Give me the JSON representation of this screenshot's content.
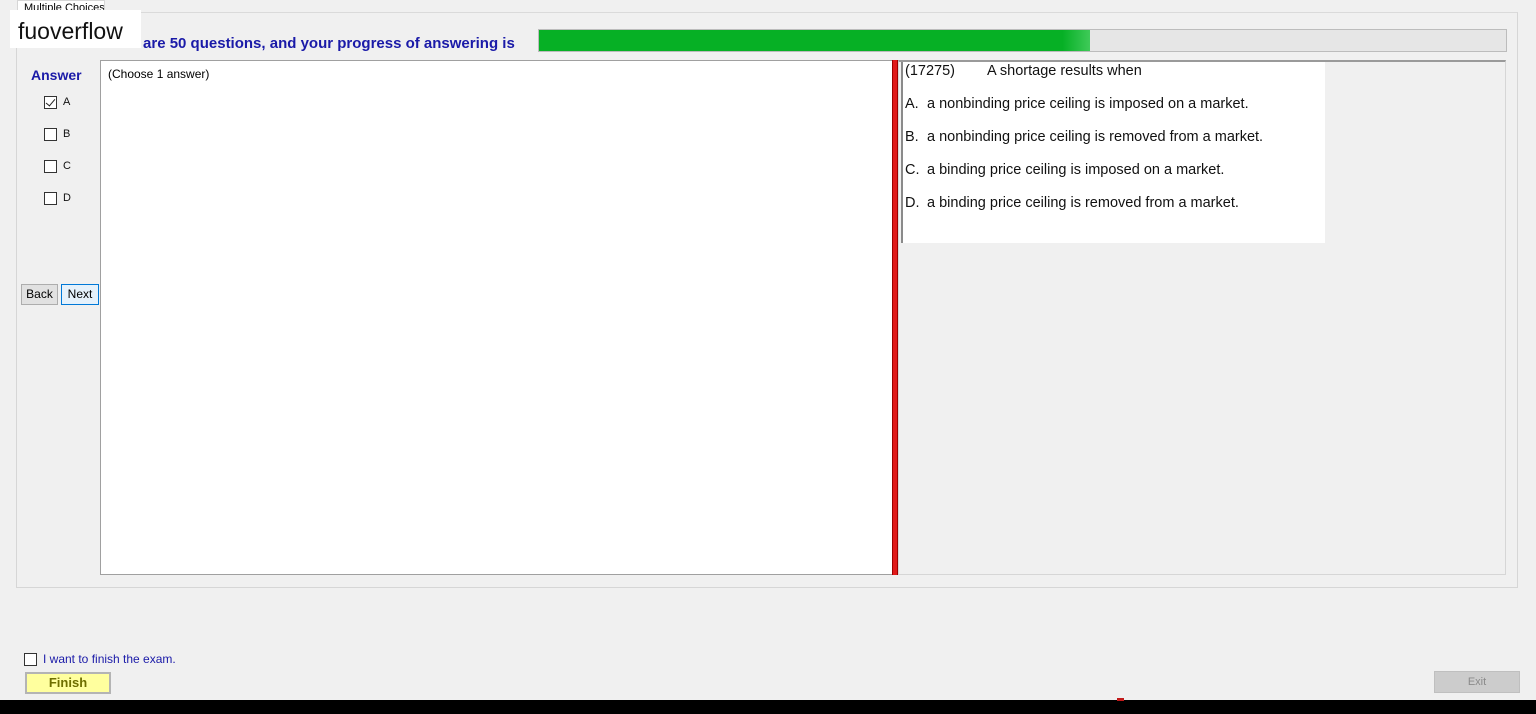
{
  "tab": {
    "label": "Multiple Choices"
  },
  "watermark": {
    "text": "fuoverflow"
  },
  "progress": {
    "label": "There are 50 questions, and your progress of answering is",
    "fraction": 0.57,
    "color": "#06b025"
  },
  "answer_panel": {
    "title": "Answer",
    "options": [
      {
        "label": "A",
        "checked": true
      },
      {
        "label": "B",
        "checked": false
      },
      {
        "label": "C",
        "checked": false
      },
      {
        "label": "D",
        "checked": false
      }
    ],
    "back_label": "Back",
    "next_label": "Next"
  },
  "answer_area": {
    "text": "(Choose 1 answer)"
  },
  "question": {
    "number": "(17275)",
    "stem": "A shortage results when",
    "choices": [
      {
        "letter": "A.",
        "text": "a nonbinding price ceiling is imposed on a market."
      },
      {
        "letter": "B.",
        "text": "a nonbinding price ceiling is removed from a market."
      },
      {
        "letter": "C.",
        "text": "a binding price ceiling is imposed on a market."
      },
      {
        "letter": "D.",
        "text": "a binding price ceiling is removed from a market."
      }
    ]
  },
  "footer": {
    "finish_check_label": "I want to finish the exam.",
    "finish_checked": false,
    "finish_label": "Finish",
    "exit_label": "Exit"
  },
  "colors": {
    "heading_blue": "#1a1aa8",
    "splitter_red": "#e01a1a",
    "finish_yellow": "#ffff9e"
  }
}
